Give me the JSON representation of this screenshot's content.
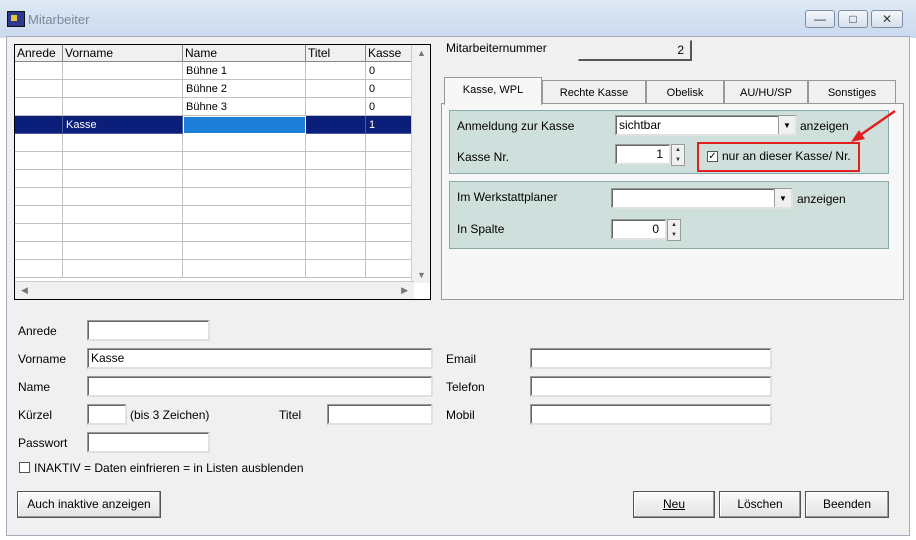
{
  "window": {
    "title": "Mitarbeiter",
    "btn_min": "—",
    "btn_max": "□",
    "btn_close": "✕"
  },
  "grid": {
    "headers": [
      "Anrede",
      "Vorname",
      "Name",
      "Titel",
      "Kasse"
    ],
    "rows": [
      [
        "",
        "",
        "Bühne 1",
        "",
        "0"
      ],
      [
        "",
        "",
        "Bühne 2",
        "",
        "0"
      ],
      [
        "",
        "",
        "Bühne 3",
        "",
        "0"
      ],
      [
        "",
        "Kasse",
        "",
        "",
        "1"
      ]
    ],
    "selected_row": 3
  },
  "mitarbeiternummer": {
    "label": "Mitarbeiternummer",
    "value": "2"
  },
  "tabs": [
    "Kasse, WPL",
    "Rechte Kasse",
    "Obelisk",
    "AU/HU/SP",
    "Sonstiges"
  ],
  "kasse_group": {
    "anmeldung_label": "Anmeldung zur Kasse",
    "anmeldung_value": "sichtbar",
    "anzeigen": "anzeigen",
    "kasse_nr_label": "Kasse Nr.",
    "kasse_nr_value": "1",
    "nur_kasse_label": "nur an dieser Kasse/ Nr.",
    "nur_kasse_checked": "✓"
  },
  "wpl_group": {
    "werkstatt_label": "Im Werkstattplaner",
    "werkstatt_value": "",
    "anzeigen": "anzeigen",
    "spalte_label": "In Spalte",
    "spalte_value": "0"
  },
  "form": {
    "anrede_label": "Anrede",
    "anrede_value": "",
    "vorname_label": "Vorname",
    "vorname_value": "Kasse",
    "name_label": "Name",
    "name_value": "",
    "kuerzel_label": "Kürzel",
    "kuerzel_value": "",
    "kuerzel_hint": "(bis 3 Zeichen)",
    "titel_label": "Titel",
    "titel_value": "",
    "passwort_label": "Passwort",
    "passwort_value": "",
    "email_label": "Email",
    "email_value": "",
    "telefon_label": "Telefon",
    "telefon_value": "",
    "mobil_label": "Mobil",
    "mobil_value": "",
    "inaktiv_label": "INAKTIV = Daten einfrieren = in Listen ausblenden"
  },
  "buttons": {
    "inaktive": "Auch inaktive anzeigen",
    "neu": "Neu",
    "loeschen": "Löschen",
    "beenden": "Beenden"
  },
  "colors": {
    "highlight": "#e02020",
    "selection": "#0b1f7a",
    "group_bg": "#cfe0dc"
  }
}
